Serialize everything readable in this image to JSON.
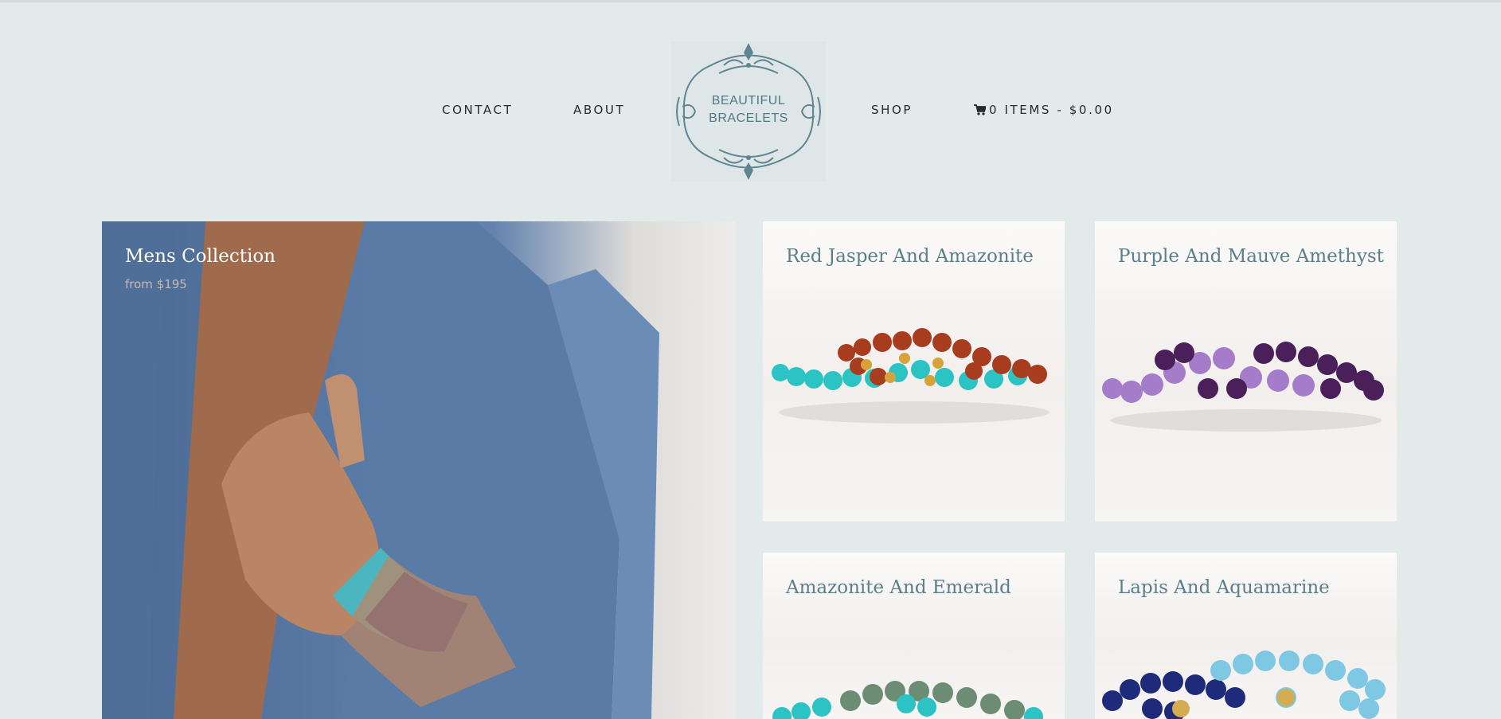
{
  "header": {
    "nav": {
      "contact": "CONTACT",
      "about": "ABOUT",
      "shop": "SHOP",
      "cart": "0 ITEMS - $0.00"
    },
    "logo": {
      "line1": "BEAUTIFUL",
      "line2": "BRACELETS"
    }
  },
  "tiles": {
    "mens": {
      "title": "Mens Collection",
      "subtitle": "from $195"
    },
    "red_jasper": {
      "title": "Red Jasper And Amazonite"
    },
    "purple": {
      "title": "Purple And Mauve Amethyst"
    },
    "amazonite": {
      "title": "Amazonite And Emerald"
    },
    "lapis": {
      "title": "Lapis And Aquamarine"
    }
  },
  "colors": {
    "background": "#e3eaea",
    "tile_title": "#5a7f8b",
    "logo": "#4e7a85"
  },
  "icons": [
    "shopping-cart-icon",
    "ornamental-logo"
  ]
}
